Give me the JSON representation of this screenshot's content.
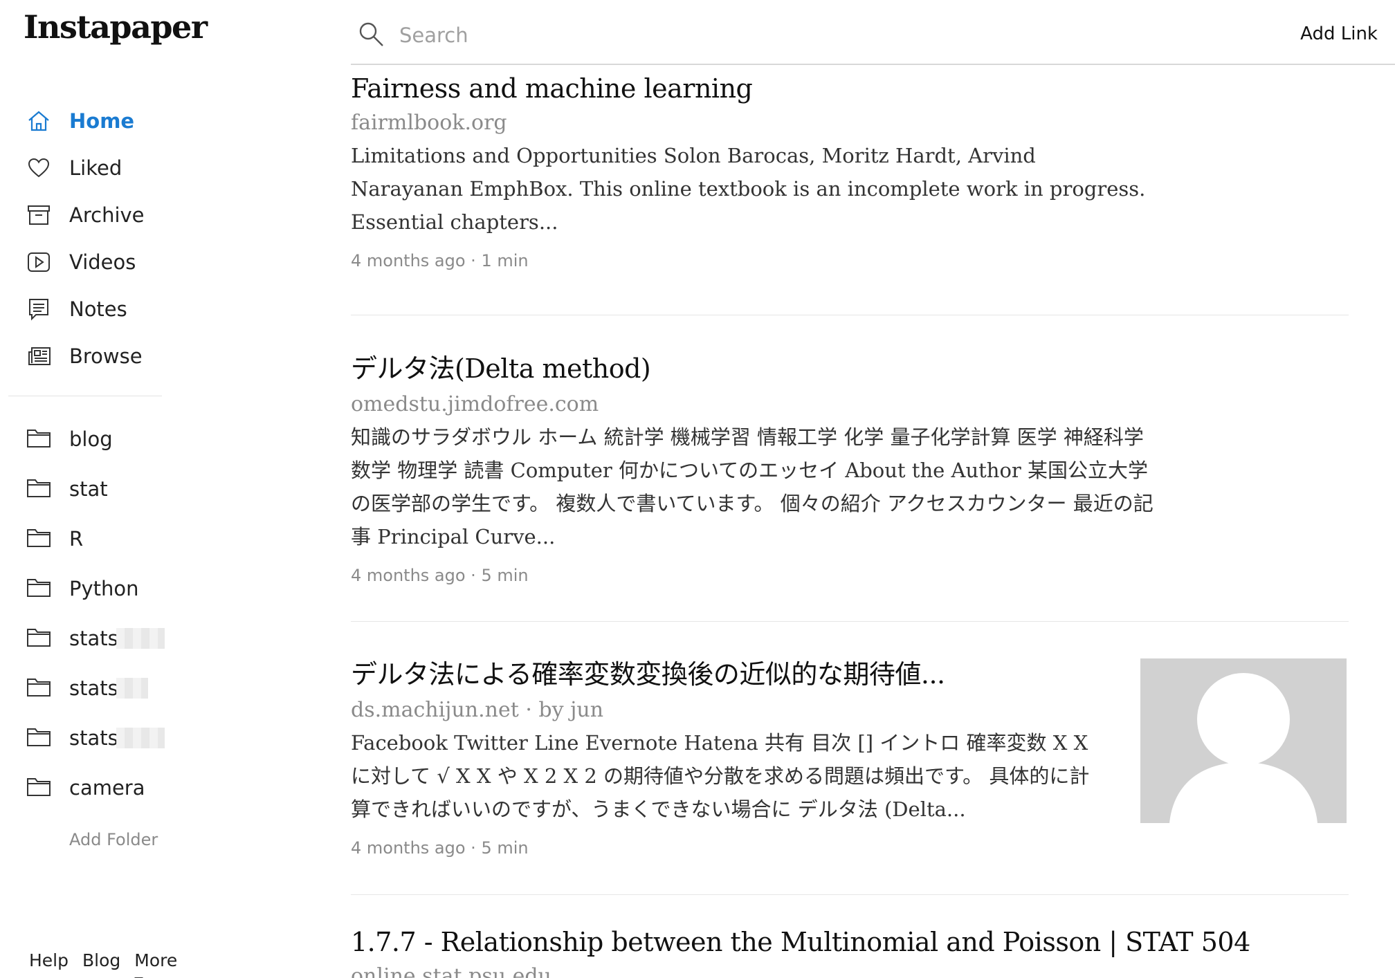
{
  "app": {
    "logo": "Instapaper"
  },
  "nav": [
    {
      "id": "home",
      "label": "Home",
      "icon": "home-icon",
      "active": true
    },
    {
      "id": "liked",
      "label": "Liked",
      "icon": "heart-icon"
    },
    {
      "id": "archive",
      "label": "Archive",
      "icon": "archive-box-icon"
    },
    {
      "id": "videos",
      "label": "Videos",
      "icon": "video-icon"
    },
    {
      "id": "notes",
      "label": "Notes",
      "icon": "notes-icon"
    },
    {
      "id": "browse",
      "label": "Browse",
      "icon": "newspaper-icon"
    }
  ],
  "folders": [
    {
      "label": "blog"
    },
    {
      "label": "stat"
    },
    {
      "label": "R"
    },
    {
      "label": "Python"
    },
    {
      "label": "stats"
    },
    {
      "label": "stats"
    },
    {
      "label": "stats"
    },
    {
      "label": "camera"
    }
  ],
  "add_folder": "Add Folder",
  "footer": {
    "help": "Help",
    "blog": "Blog",
    "more": "More ▿"
  },
  "search": {
    "placeholder": "Search"
  },
  "add_link": "Add Link",
  "colors": {
    "accent": "#1a7bd1",
    "muted": "#8a8a8a",
    "thumb_bg": "#d1d1d1"
  },
  "articles": [
    {
      "title": "Fairness and machine learning",
      "source": "fairmlbook.org",
      "excerpt": "Limitations and Opportunities Solon Barocas, Moritz Hardt, Arvind Narayanan EmphBox. This online textbook is an incomplete work in progress. Essential chapters...",
      "meta": "4 months ago · 1 min"
    },
    {
      "title": "デルタ法(Delta method)",
      "source": "omedstu.jimdofree.com",
      "excerpt": "知識のサラダボウル ホーム 統計学 機械学習 情報工学 化学 量子化学計算 医学 神経科学 数学 物理学 読書 Computer 何かについてのエッセイ About the Author 某国公立大学の医学部の学生です。 複数人で書いています。 個々の紹介 アクセスカウンター 最近の記事 Principal Curve...",
      "meta": "4 months ago · 5 min"
    },
    {
      "title": "デルタ法による確率変数変換後の近似的な期待値...",
      "source": "ds.machijun.net · by jun",
      "excerpt": "Facebook Twitter Line Evernote Hatena 共有 目次 [] イントロ 確率変数 X X に対して √ X X や X 2 X 2 の期待値や分散を求める問題は頻出です。 具体的に計算できればいいのですが、うまくできない場合に デルタ法 (Delta...",
      "meta": "4 months ago · 5 min"
    },
    {
      "title": "1.7.7 - Relationship between the Multinomial and Poisson | STAT 504",
      "source": "online.stat.psu.edu"
    }
  ]
}
